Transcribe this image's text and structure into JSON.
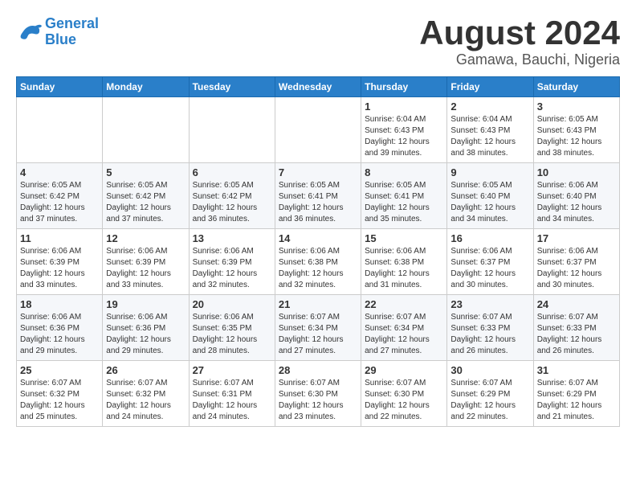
{
  "header": {
    "logo_line1": "General",
    "logo_line2": "Blue",
    "month_year": "August 2024",
    "location": "Gamawa, Bauchi, Nigeria"
  },
  "weekdays": [
    "Sunday",
    "Monday",
    "Tuesday",
    "Wednesday",
    "Thursday",
    "Friday",
    "Saturday"
  ],
  "weeks": [
    [
      {
        "day": "",
        "info": ""
      },
      {
        "day": "",
        "info": ""
      },
      {
        "day": "",
        "info": ""
      },
      {
        "day": "",
        "info": ""
      },
      {
        "day": "1",
        "info": "Sunrise: 6:04 AM\nSunset: 6:43 PM\nDaylight: 12 hours\nand 39 minutes."
      },
      {
        "day": "2",
        "info": "Sunrise: 6:04 AM\nSunset: 6:43 PM\nDaylight: 12 hours\nand 38 minutes."
      },
      {
        "day": "3",
        "info": "Sunrise: 6:05 AM\nSunset: 6:43 PM\nDaylight: 12 hours\nand 38 minutes."
      }
    ],
    [
      {
        "day": "4",
        "info": "Sunrise: 6:05 AM\nSunset: 6:42 PM\nDaylight: 12 hours\nand 37 minutes."
      },
      {
        "day": "5",
        "info": "Sunrise: 6:05 AM\nSunset: 6:42 PM\nDaylight: 12 hours\nand 37 minutes."
      },
      {
        "day": "6",
        "info": "Sunrise: 6:05 AM\nSunset: 6:42 PM\nDaylight: 12 hours\nand 36 minutes."
      },
      {
        "day": "7",
        "info": "Sunrise: 6:05 AM\nSunset: 6:41 PM\nDaylight: 12 hours\nand 36 minutes."
      },
      {
        "day": "8",
        "info": "Sunrise: 6:05 AM\nSunset: 6:41 PM\nDaylight: 12 hours\nand 35 minutes."
      },
      {
        "day": "9",
        "info": "Sunrise: 6:05 AM\nSunset: 6:40 PM\nDaylight: 12 hours\nand 34 minutes."
      },
      {
        "day": "10",
        "info": "Sunrise: 6:06 AM\nSunset: 6:40 PM\nDaylight: 12 hours\nand 34 minutes."
      }
    ],
    [
      {
        "day": "11",
        "info": "Sunrise: 6:06 AM\nSunset: 6:39 PM\nDaylight: 12 hours\nand 33 minutes."
      },
      {
        "day": "12",
        "info": "Sunrise: 6:06 AM\nSunset: 6:39 PM\nDaylight: 12 hours\nand 33 minutes."
      },
      {
        "day": "13",
        "info": "Sunrise: 6:06 AM\nSunset: 6:39 PM\nDaylight: 12 hours\nand 32 minutes."
      },
      {
        "day": "14",
        "info": "Sunrise: 6:06 AM\nSunset: 6:38 PM\nDaylight: 12 hours\nand 32 minutes."
      },
      {
        "day": "15",
        "info": "Sunrise: 6:06 AM\nSunset: 6:38 PM\nDaylight: 12 hours\nand 31 minutes."
      },
      {
        "day": "16",
        "info": "Sunrise: 6:06 AM\nSunset: 6:37 PM\nDaylight: 12 hours\nand 30 minutes."
      },
      {
        "day": "17",
        "info": "Sunrise: 6:06 AM\nSunset: 6:37 PM\nDaylight: 12 hours\nand 30 minutes."
      }
    ],
    [
      {
        "day": "18",
        "info": "Sunrise: 6:06 AM\nSunset: 6:36 PM\nDaylight: 12 hours\nand 29 minutes."
      },
      {
        "day": "19",
        "info": "Sunrise: 6:06 AM\nSunset: 6:36 PM\nDaylight: 12 hours\nand 29 minutes."
      },
      {
        "day": "20",
        "info": "Sunrise: 6:06 AM\nSunset: 6:35 PM\nDaylight: 12 hours\nand 28 minutes."
      },
      {
        "day": "21",
        "info": "Sunrise: 6:07 AM\nSunset: 6:34 PM\nDaylight: 12 hours\nand 27 minutes."
      },
      {
        "day": "22",
        "info": "Sunrise: 6:07 AM\nSunset: 6:34 PM\nDaylight: 12 hours\nand 27 minutes."
      },
      {
        "day": "23",
        "info": "Sunrise: 6:07 AM\nSunset: 6:33 PM\nDaylight: 12 hours\nand 26 minutes."
      },
      {
        "day": "24",
        "info": "Sunrise: 6:07 AM\nSunset: 6:33 PM\nDaylight: 12 hours\nand 26 minutes."
      }
    ],
    [
      {
        "day": "25",
        "info": "Sunrise: 6:07 AM\nSunset: 6:32 PM\nDaylight: 12 hours\nand 25 minutes."
      },
      {
        "day": "26",
        "info": "Sunrise: 6:07 AM\nSunset: 6:32 PM\nDaylight: 12 hours\nand 24 minutes."
      },
      {
        "day": "27",
        "info": "Sunrise: 6:07 AM\nSunset: 6:31 PM\nDaylight: 12 hours\nand 24 minutes."
      },
      {
        "day": "28",
        "info": "Sunrise: 6:07 AM\nSunset: 6:30 PM\nDaylight: 12 hours\nand 23 minutes."
      },
      {
        "day": "29",
        "info": "Sunrise: 6:07 AM\nSunset: 6:30 PM\nDaylight: 12 hours\nand 22 minutes."
      },
      {
        "day": "30",
        "info": "Sunrise: 6:07 AM\nSunset: 6:29 PM\nDaylight: 12 hours\nand 22 minutes."
      },
      {
        "day": "31",
        "info": "Sunrise: 6:07 AM\nSunset: 6:29 PM\nDaylight: 12 hours\nand 21 minutes."
      }
    ]
  ]
}
